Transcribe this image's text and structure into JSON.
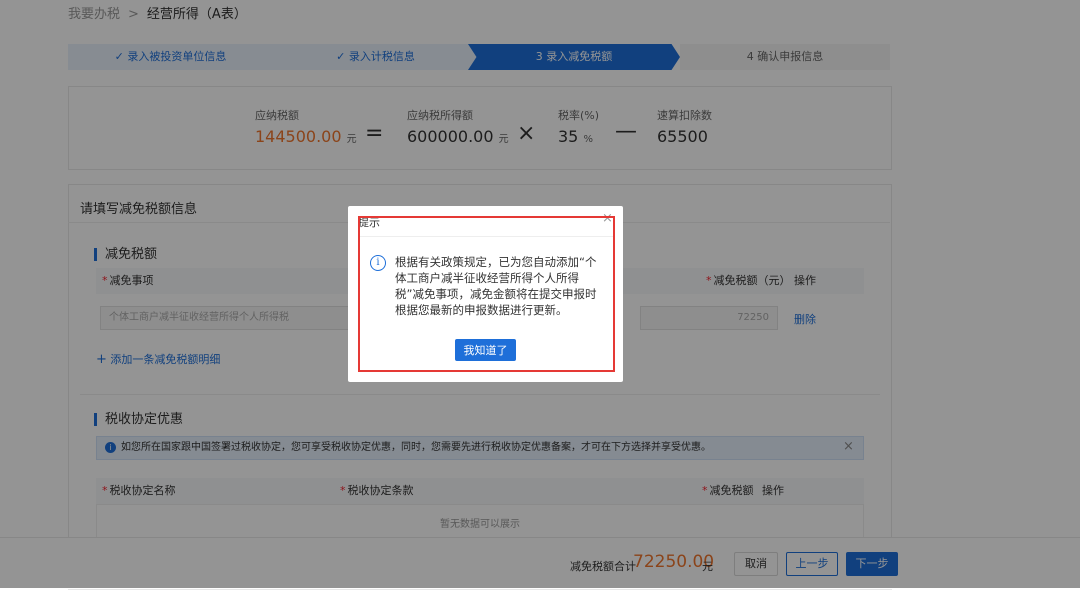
{
  "breadcrumb": {
    "root": "我要办税",
    "separator": ">",
    "current": "经营所得（A表）"
  },
  "steps": [
    {
      "label": "✓ 录入被投资单位信息",
      "state": "done"
    },
    {
      "label": "✓ 录入计税信息",
      "state": "done"
    },
    {
      "label": "3 录入减免税额",
      "state": "active"
    },
    {
      "label": "4 确认申报信息",
      "state": "pending"
    }
  ],
  "formula": {
    "tax_payable_label": "应纳税额",
    "tax_payable_value": "144500.00",
    "unit": "元",
    "equals": "=",
    "taxable_income_label": "应纳税所得额",
    "taxable_income_value": "600000.00",
    "times": "×",
    "rate_label": "税率(%)",
    "rate_value": "35",
    "percent": "%",
    "minus": "—",
    "quick_deduction_label": "速算扣除数",
    "quick_deduction_value": "65500"
  },
  "panel": {
    "title": "请填写减免税额信息"
  },
  "reduction": {
    "section_title": "减免税额",
    "col_item": "减免事项",
    "col_amount": "减免税额（元）",
    "col_action": "操作",
    "row_item": "个体工商户减半征收经营所得个人所得税",
    "row_amount": "72250",
    "row_delete": "删除",
    "add_link": "添加一条减免税额明细"
  },
  "treaty": {
    "section_title": "税收协定优惠",
    "notice": "如您所在国家跟中国签署过税收协定，您可享受税收协定优惠，同时，您需要先进行税收协定优惠备案，才可在下方选择并享受优惠。",
    "col_name": "税收协定名称",
    "col_clause": "税收协定条款",
    "col_amount": "减免税额",
    "col_action": "操作",
    "empty": "暂无数据可以展示"
  },
  "footer": {
    "total_label": "减免税额合计",
    "total_value": "72250.00",
    "unit": "元",
    "cancel": "取消",
    "prev": "上一步",
    "next": "下一步"
  },
  "dialog": {
    "title": "提示",
    "message": "根据有关政策规定，已为您自动添加“个体工商户减半征收经营所得个人所得税”减免事项，减免金额将在提交申报时根据您最新的申报数据进行更新。",
    "confirm": "我知道了"
  },
  "colors": {
    "primary": "#1e6fd9",
    "accent_orange": "#f0762d",
    "highlight_red": "#e53935"
  },
  "icons": {
    "info": "info-circle-icon",
    "close": "close-icon",
    "plus": "plus-icon",
    "check": "check-icon"
  }
}
